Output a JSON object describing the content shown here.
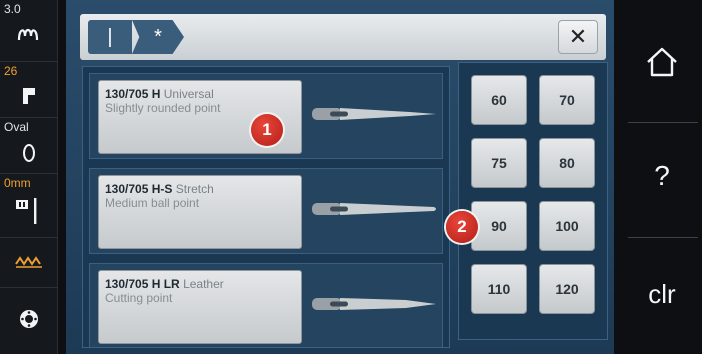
{
  "sidebar": {
    "stitch_length": {
      "value": "3.0",
      "icon": "stitch-pattern-icon"
    },
    "stitch_number": {
      "value": "26",
      "icon": "presser-foot-icon"
    },
    "foot": {
      "value": "Oval",
      "icon": "oval-foot-icon"
    },
    "needle_position": {
      "value": "0mm",
      "icon": "needle-position-icon"
    },
    "pattern": {
      "icon": "zigzag-pattern-icon"
    },
    "settings": {
      "icon": "bobbin-icon"
    },
    "colors": {
      "accent": "#f0a030"
    }
  },
  "tabs": [
    {
      "label": "|",
      "icon": "needle-icon"
    },
    {
      "label": "*",
      "icon": "needle-thread-icon"
    }
  ],
  "close_label": "✕",
  "needles": [
    {
      "code": "130/705 H",
      "type": "Universal",
      "description": "Slightly rounded point"
    },
    {
      "code": "130/705 H-S",
      "type": "Stretch",
      "description": "Medium ball point"
    },
    {
      "code": "130/705 H LR",
      "type": "Leather",
      "description": "Cutting point"
    }
  ],
  "sizes": [
    "60",
    "70",
    "75",
    "80",
    "90",
    "100",
    "110",
    "120"
  ],
  "badges": [
    "1",
    "2"
  ],
  "right_bar": {
    "home_icon": "home-icon",
    "help_label": "?",
    "clear_label": "clr"
  }
}
